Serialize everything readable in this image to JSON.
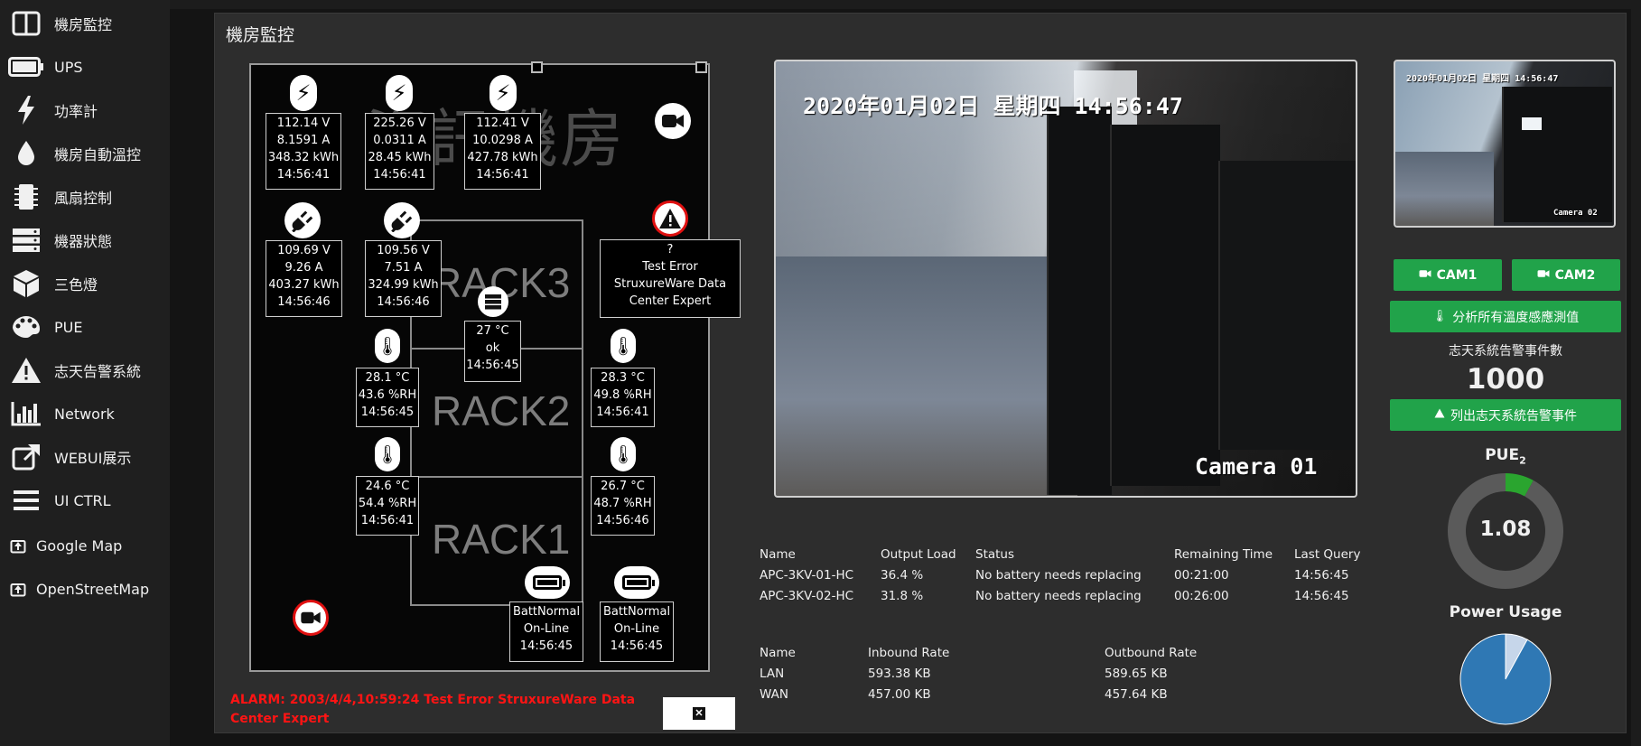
{
  "sidebar": {
    "items": [
      {
        "label": "機房監控",
        "icon": "columns-icon"
      },
      {
        "label": "UPS",
        "icon": "battery-icon"
      },
      {
        "label": "功率計",
        "icon": "bolt-icon"
      },
      {
        "label": "機房自動溫控",
        "icon": "tint-icon"
      },
      {
        "label": "風扇控制",
        "icon": "microchip-icon"
      },
      {
        "label": "機器狀態",
        "icon": "server-icon"
      },
      {
        "label": "三色燈",
        "icon": "cube-icon"
      },
      {
        "label": "PUE",
        "icon": "palette-icon"
      },
      {
        "label": "志天告警系統",
        "icon": "warning-icon"
      },
      {
        "label": "Network",
        "icon": "chart-bar-icon"
      },
      {
        "label": "WEBUI展示",
        "icon": "external-link-icon"
      },
      {
        "label": "UI CTRL",
        "icon": "bars-icon"
      },
      {
        "label": "Google Map",
        "icon": "sign-in-icon"
      },
      {
        "label": "OpenStreetMap",
        "icon": "sign-in-icon"
      }
    ]
  },
  "page_title": "機房監控",
  "floorplan": {
    "room_name": "資訊機房",
    "racks": [
      "RACK3",
      "RACK2",
      "RACK1"
    ],
    "power_meters": [
      {
        "voltage": "112.14 V",
        "current": "8.1591 A",
        "energy": "348.32 kWh",
        "time": "14:56:41"
      },
      {
        "voltage": "225.26 V",
        "current": "0.0311 A",
        "energy": "28.45 kWh",
        "time": "14:56:41"
      },
      {
        "voltage": "112.41 V",
        "current": "10.0298 A",
        "energy": "427.78 kWh",
        "time": "14:56:41"
      },
      {
        "voltage": "109.69 V",
        "current": "9.26 A",
        "energy": "403.27 kWh",
        "time": "14:56:46"
      },
      {
        "voltage": "109.56 V",
        "current": "7.51 A",
        "energy": "324.99 kWh",
        "time": "14:56:46"
      }
    ],
    "alert": {
      "code": "?",
      "line1": "Test Error",
      "line2": "StruxureWare Data",
      "line3": "Center Expert"
    },
    "server": {
      "temp": "27 °C",
      "status": "ok",
      "time": "14:56:45"
    },
    "sensors": [
      {
        "temp": "28.1 °C",
        "rh": "43.6 %RH",
        "time": "14:56:45"
      },
      {
        "temp": "28.3 °C",
        "rh": "49.8 %RH",
        "time": "14:56:41"
      },
      {
        "temp": "24.6 °C",
        "rh": "54.4 %RH",
        "time": "14:56:41"
      },
      {
        "temp": "26.7 °C",
        "rh": "48.7 %RH",
        "time": "14:56:46"
      }
    ],
    "ups": [
      {
        "status": "BattNormal",
        "mode": "On-Line",
        "time": "14:56:45"
      },
      {
        "status": "BattNormal",
        "mode": "On-Line",
        "time": "14:56:45"
      }
    ],
    "alarm_text": "ALARM: 2003/4/4,10:59:24 Test Error StruxureWare Data Center Expert"
  },
  "cameras": {
    "main": {
      "timestamp": "2020年01月02日 星期四 14:56:47",
      "label": "Camera 01"
    },
    "side": {
      "timestamp": "2020年01月02日 星期四 14:56:47",
      "label": "Camera 02"
    },
    "cam1_label": "CAM1",
    "cam2_label": "CAM2"
  },
  "right_panel": {
    "analyze_button": "分析所有溫度感應測值",
    "alarm_count_label": "志天系統告警事件數",
    "alarm_count": "1000",
    "list_alarms_button": "列出志天系統告警事件",
    "pue_label": "PUE",
    "pue_subscript": "2",
    "pue_value": "1.08",
    "power_usage_label": "Power Usage"
  },
  "ups_table": {
    "headers": [
      "Name",
      "Output Load",
      "Status",
      "Remaining Time",
      "Last Query"
    ],
    "rows": [
      [
        "APC-3KV-01-HC",
        "36.4 %",
        "No battery needs replacing",
        "00:21:00",
        "14:56:45"
      ],
      [
        "APC-3KV-02-HC",
        "31.8 %",
        "No battery needs replacing",
        "00:26:00",
        "14:56:45"
      ]
    ]
  },
  "network_table": {
    "headers": [
      "Name",
      "Inbound Rate",
      "Outbound Rate"
    ],
    "rows": [
      [
        "LAN",
        "593.38 KB",
        "589.65 KB"
      ],
      [
        "WAN",
        "457.00 KB",
        "457.64 KB"
      ]
    ]
  },
  "chart_data": [
    {
      "type": "pie",
      "title": "PUE2",
      "center_label": "1.08",
      "values": [
        0.08,
        0.92
      ],
      "colors": [
        "#2aa52f",
        "#5a5a5a"
      ]
    },
    {
      "type": "pie",
      "title": "Power Usage",
      "values": [
        0.08,
        0.92
      ],
      "colors": [
        "#c6d6ea",
        "#2f78b4"
      ]
    }
  ],
  "colors": {
    "accent_green": "#21a34a",
    "alarm_red": "#ff1414"
  }
}
